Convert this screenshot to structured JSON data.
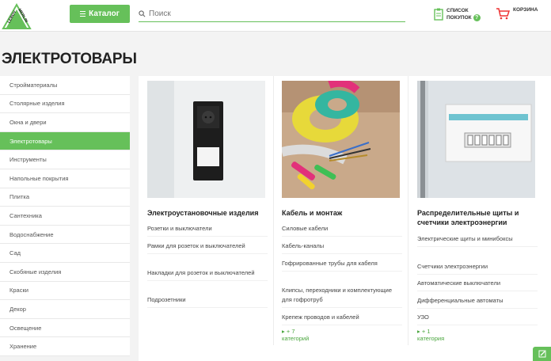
{
  "header": {
    "logo_text": "LEROY MERLIN",
    "catalog_label": "Каталог",
    "search_placeholder": "Поиск",
    "shoplist_line1": "Список",
    "shoplist_line2": "покупок",
    "shoplist_badge": "?",
    "cart_label": "Корзина"
  },
  "page": {
    "title": "ЭЛЕКТРОТОВАРЫ"
  },
  "sidebar": {
    "items": [
      {
        "label": "Стройматериалы"
      },
      {
        "label": "Столярные изделия"
      },
      {
        "label": "Окна и двери"
      },
      {
        "label": "Электротовары"
      },
      {
        "label": "Инструменты"
      },
      {
        "label": "Напольные покрытия"
      },
      {
        "label": "Плитка"
      },
      {
        "label": "Сантехника"
      },
      {
        "label": "Водоснабжение"
      },
      {
        "label": "Сад"
      },
      {
        "label": "Скобяные изделия"
      },
      {
        "label": "Краски"
      },
      {
        "label": "Декор"
      },
      {
        "label": "Освещение"
      },
      {
        "label": "Хранение"
      }
    ]
  },
  "cards": [
    {
      "title": "Электроустановочные изделия",
      "links": [
        "Розетки и выключатели",
        "Рамки для розеток и выключателей",
        "Накладки для розеток и выключателей",
        "Подрозетники"
      ]
    },
    {
      "title": "Кабель и монтаж",
      "links": [
        "Силовые кабели",
        "Кабель-каналы",
        "Гофрированные трубы для кабеля",
        "Клипсы, переходники и комплектующие для гофротруб",
        "Крепеж проводов и кабелей"
      ],
      "more": "+ 7 категорий"
    },
    {
      "title": "Распределительные щиты и счетчики электроэнергии",
      "links": [
        "Электрические щиты и минибоксы",
        "Счетчики электроэнергии",
        "Автоматические выключатели",
        "Дифференциальные автоматы",
        "УЗО"
      ],
      "more": "+ 1 категория"
    }
  ],
  "colors": {
    "accent": "#66c05a",
    "accent_text": "#4aa63e"
  }
}
